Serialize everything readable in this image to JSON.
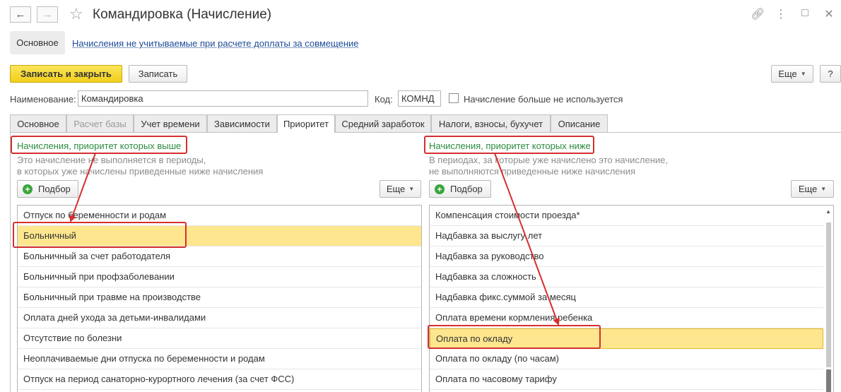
{
  "window": {
    "title": "Командировка (Начисление)",
    "icons": [
      "link-icon",
      "more-icon",
      "maximize-icon",
      "close-icon"
    ]
  },
  "topnav": {
    "main": "Основное",
    "link": "Начисления не учитываемые при расчете доплаты за совмещение"
  },
  "commandbar": {
    "save_close": "Записать и закрыть",
    "save": "Записать",
    "more": "Еще",
    "help": "?"
  },
  "fields": {
    "name_label": "Наименование:",
    "name_value": "Командировка",
    "code_label": "Код:",
    "code_value": "КОМНД",
    "unused_label": "Начисление больше не используется"
  },
  "tabs": [
    {
      "label": "Основное"
    },
    {
      "label": "Расчет базы"
    },
    {
      "label": "Учет времени"
    },
    {
      "label": "Зависимости"
    },
    {
      "label": "Приоритет"
    },
    {
      "label": "Средний заработок"
    },
    {
      "label": "Налоги, взносы, бухучет"
    },
    {
      "label": "Описание"
    }
  ],
  "active_tab": "Приоритет",
  "left_group": {
    "header": "Начисления, приоритет которых выше",
    "hint1": "Это начисление не выполняется в периоды,",
    "hint2": "в которых уже начислены приведенные ниже начисления",
    "pick": "Подбор",
    "more": "Еще",
    "rows": [
      "Отпуск по беременности и родам",
      "Больничный",
      "Больничный за счет работодателя",
      "Больничный при профзаболевании",
      "Больничный при травме на производстве",
      "Оплата дней ухода за детьми-инвалидами",
      "Отсутствие по болезни",
      "Неоплачиваемые дни отпуска по беременности и родам",
      "Отпуск на период санаторно-курортного лечения (за счет ФСС)"
    ],
    "selected_index": 1
  },
  "right_group": {
    "header": "Начисления, приоритет которых ниже",
    "hint1": "В периодах, за которые уже начислено это начисление,",
    "hint2": "не выполняются приведенные ниже начисления",
    "pick": "Подбор",
    "more": "Еще",
    "rows": [
      "Компенсация стоимости проезда*",
      "Надбавка за выслугу лет",
      "Надбавка за руководство",
      "Надбавка за сложность",
      "Надбавка фикс.суммой за месяц",
      "Оплата времени кормления ребенка",
      "Оплата по окладу",
      "Оплата по окладу (по часам)",
      "Оплата по часовому тарифу"
    ],
    "selected_index": 6
  },
  "colors": {
    "accent_yellow": "#f2cf1c",
    "selection": "#fde68e",
    "annotation_red": "#d62f2f",
    "group_header_green": "#2b8a3e",
    "link_blue": "#1c4a96"
  }
}
